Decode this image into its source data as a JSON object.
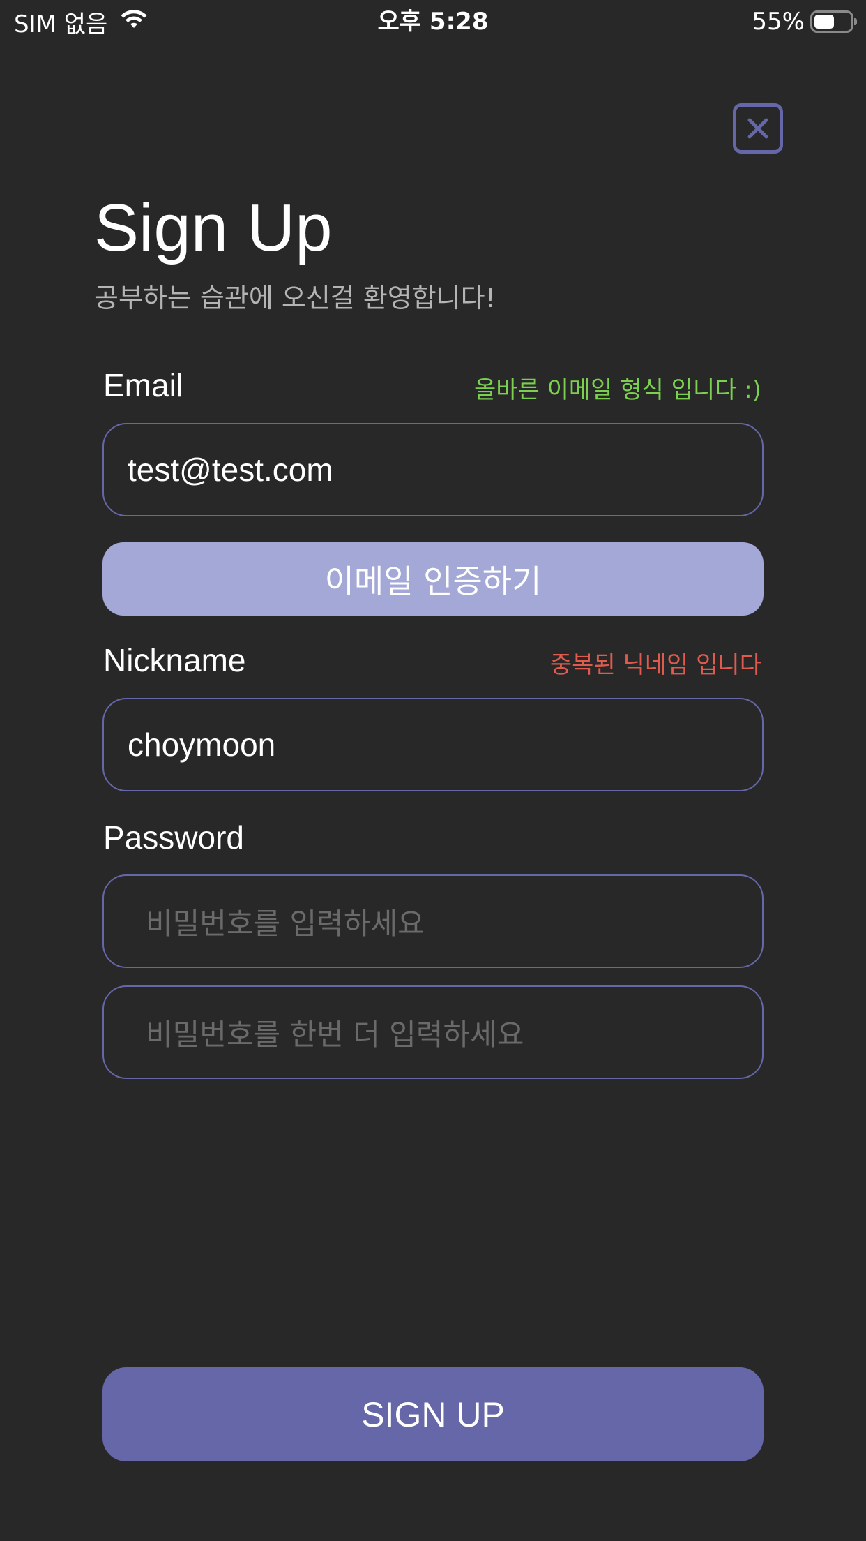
{
  "status_bar": {
    "carrier": "SIM 없음",
    "time": "오후 5:28",
    "battery_percent": "55%",
    "battery_level": 0.55,
    "icons": [
      "wifi-icon",
      "battery-icon"
    ]
  },
  "header": {
    "close_icon": "close-icon",
    "title": "Sign Up",
    "subtitle": "공부하는 습관에 오신걸 환영합니다!"
  },
  "email": {
    "label": "Email",
    "hint": "올바른 이메일 형식 입니다 :)",
    "value": "test@test.com",
    "verify_button": "이메일 인증하기"
  },
  "nickname": {
    "label": "Nickname",
    "hint": "중복된 닉네임 입니다",
    "value": "choymoon"
  },
  "password": {
    "label": "Password",
    "placeholder": "비밀번호를 입력하세요",
    "confirm_placeholder": "비밀번호를 한번 더 입력하세요"
  },
  "signup_button": "SIGN UP",
  "colors": {
    "background": "#282828",
    "accent": "#6567a8",
    "verify_button": "#a4a8d7",
    "hint_ok": "#7bd14f",
    "hint_error": "#e05a4e",
    "subtitle": "#b4b4b4",
    "placeholder": "#6a6a6a"
  }
}
